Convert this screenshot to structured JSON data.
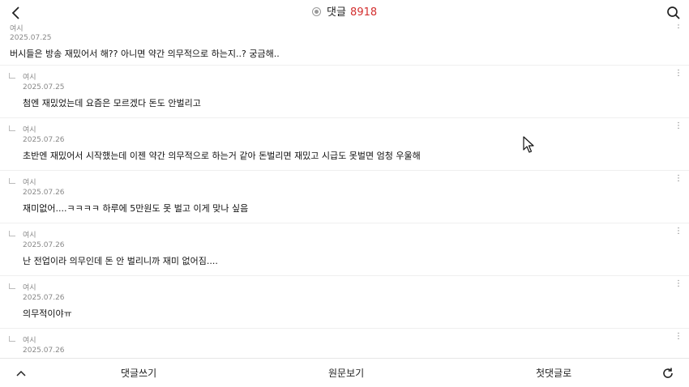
{
  "header": {
    "title": "댓글",
    "count": "8918",
    "back_icon": "chevron-left-icon",
    "search_icon": "search-icon",
    "count_color": "#d32f2f"
  },
  "comments": [
    {
      "author": "여시",
      "date": "2025.07.25",
      "text": "버시들은 방송 재밌어서 해?? 아니면 약간 의무적으로 하는지..? 궁금해..",
      "reply": false
    },
    {
      "author": "여시",
      "date": "2025.07.25",
      "text": "첨엔 재밌었는데 요즘은 모르겠다 돈도 안벌리고",
      "reply": true
    },
    {
      "author": "여시",
      "date": "2025.07.26",
      "text": "초반엔 재밌어서 시작했는데 이젠 약간 의무적으로 하는거 같아 돈벌리면 재밌고 시급도 못벌면 엄청 우울해",
      "reply": true
    },
    {
      "author": "여시",
      "date": "2025.07.26",
      "text": "재미없어....ㅋㅋㅋㅋ 하루에 5만원도 못 벌고 이게 맞나 싶음",
      "reply": true
    },
    {
      "author": "여시",
      "date": "2025.07.26",
      "text": "난 전업이라 의무인데 돈 안 벌리니까 재미 없어짐....",
      "reply": true
    },
    {
      "author": "여시",
      "date": "2025.07.26",
      "text": "의무적이야ㅠ",
      "reply": true
    },
    {
      "author": "여시",
      "date": "2025.07.26",
      "text": "",
      "reply": true
    }
  ],
  "bottom": {
    "write": "댓글쓰기",
    "original": "원문보기",
    "first": "첫댓글로",
    "up_icon": "chevron-up-icon",
    "refresh_icon": "refresh-icon"
  }
}
